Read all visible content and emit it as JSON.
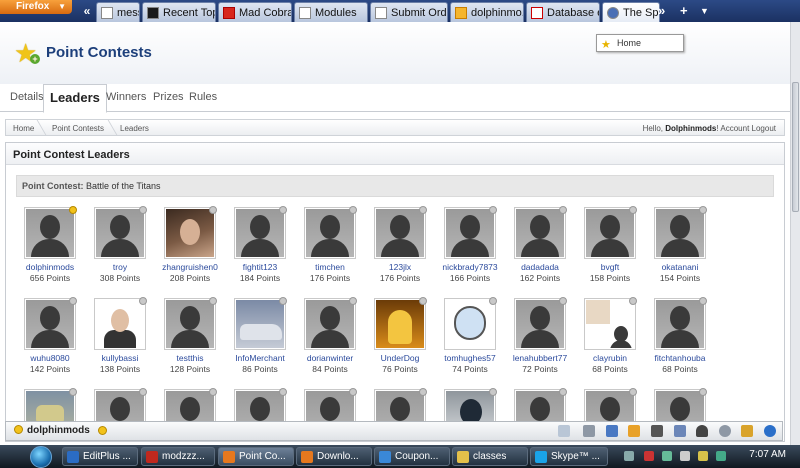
{
  "browser": {
    "menu_label": "Firefox",
    "tabs": [
      {
        "label": "messa...",
        "icon": "page-icon"
      },
      {
        "label": "Recent Topi...",
        "icon": "forum-icon"
      },
      {
        "label": "Mad Cobra ...",
        "icon": "youtube-icon"
      },
      {
        "label": "Modules",
        "icon": "page-icon"
      },
      {
        "label": "Submit Order",
        "icon": "page-icon"
      },
      {
        "label": "dolphinmo...",
        "icon": "star-icon"
      },
      {
        "label": "Database er...",
        "icon": "gmail-icon"
      },
      {
        "label": "The Spiri",
        "icon": "globe-icon"
      }
    ],
    "tooltip": "Home"
  },
  "page": {
    "title": "Point Contests",
    "tabs": [
      "Details",
      "Leaders",
      "Winners",
      "Prizes",
      "Rules"
    ],
    "active_tab": "Leaders",
    "breadcrumb": [
      "Home",
      "Point Contests",
      "Leaders"
    ],
    "greeting": "Hello,",
    "username": "Dolphinmods",
    "account_link": "Account",
    "logout_link": "Logout"
  },
  "leaders": {
    "heading": "Point Contest Leaders",
    "contest_label": "Point Contest:",
    "contest_name": "Battle of the Titans",
    "members": [
      {
        "name": "dolphinmods",
        "points": "656 Points",
        "status": "gold"
      },
      {
        "name": "troy",
        "points": "308 Points",
        "status": "grey"
      },
      {
        "name": "zhangruishen0",
        "points": "208 Points",
        "status": "grey",
        "photo": "a"
      },
      {
        "name": "fightit123",
        "points": "184 Points",
        "status": "grey"
      },
      {
        "name": "timchen",
        "points": "176 Points",
        "status": "grey"
      },
      {
        "name": "123jlx",
        "points": "176 Points",
        "status": "grey"
      },
      {
        "name": "nickbrady7873",
        "points": "166 Points",
        "status": "grey"
      },
      {
        "name": "dadadada",
        "points": "162 Points",
        "status": "grey"
      },
      {
        "name": "bvgft",
        "points": "158 Points",
        "status": "grey"
      },
      {
        "name": "okatanani",
        "points": "154 Points",
        "status": "grey"
      },
      {
        "name": "wuhu8080",
        "points": "142 Points",
        "status": "grey"
      },
      {
        "name": "kullybassi",
        "points": "138 Points",
        "status": "grey",
        "photo": "b"
      },
      {
        "name": "testthis",
        "points": "128 Points",
        "status": "grey"
      },
      {
        "name": "InfoMerchant",
        "points": "86 Points",
        "status": "grey",
        "photo": "c"
      },
      {
        "name": "dorianwinter",
        "points": "84 Points",
        "status": "grey"
      },
      {
        "name": "UnderDog",
        "points": "76 Points",
        "status": "grey",
        "photo": "d"
      },
      {
        "name": "tomhughes57",
        "points": "74 Points",
        "status": "grey",
        "photo": "e"
      },
      {
        "name": "lenahubbert77",
        "points": "72 Points",
        "status": "grey"
      },
      {
        "name": "clayrubin",
        "points": "68 Points",
        "status": "grey",
        "photo": "f"
      },
      {
        "name": "fitchtanhouba",
        "points": "68 Points",
        "status": "grey"
      }
    ]
  },
  "chatbar": {
    "username": "dolphinmods"
  },
  "taskbar": {
    "buttons": [
      {
        "label": "EditPlus ...",
        "icon": "editplus-icon",
        "color": "#2b6cc4"
      },
      {
        "label": "modzzz...",
        "icon": "filezilla-icon",
        "color": "#c0281e"
      },
      {
        "label": "Point Co...",
        "icon": "firefox-icon",
        "color": "#e6781e"
      },
      {
        "label": "Downlo...",
        "icon": "firefox-icon",
        "color": "#e6781e"
      },
      {
        "label": "Coupon...",
        "icon": "ie-icon",
        "color": "#3a88d8"
      },
      {
        "label": "classes",
        "icon": "folder-icon",
        "color": "#e4c04a"
      },
      {
        "label": "Skype™ ...",
        "icon": "skype-icon",
        "color": "#1aa3e8"
      }
    ],
    "clock": "7:07 AM"
  }
}
